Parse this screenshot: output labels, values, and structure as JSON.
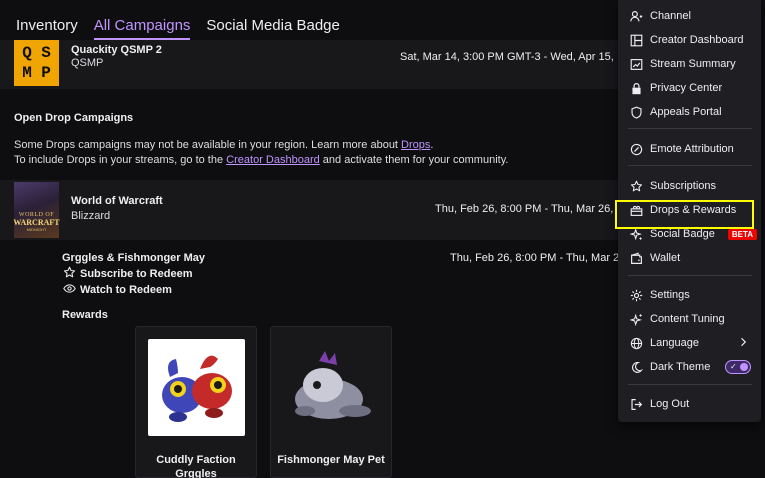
{
  "tabs": [
    {
      "label": "Inventory"
    },
    {
      "label": "All Campaigns"
    },
    {
      "label": "Social Media Badge"
    }
  ],
  "top_campaign": {
    "logo_letters": [
      "Q",
      "S",
      "M",
      "P"
    ],
    "title": "Quackity QSMP 2",
    "game": "QSMP",
    "dates": "Sat, Mar 14, 3:00 PM GMT-3 - Wed, Apr 15,"
  },
  "open_drops": {
    "heading": "Open Drop Campaigns",
    "line1_text": "Some Drops campaigns may not be available in your region. Learn more about ",
    "line1_link": "Drops",
    "line1_end": ".",
    "line2_text": "To include Drops in your streams, go to the ",
    "line2_link": "Creator Dashboard",
    "line2_end": " and activate them for your community."
  },
  "campaign": {
    "logo_text_1": "WORLD OF",
    "logo_text_2": "WARCRAFT",
    "logo_text_3": "MIDNIGHT",
    "title": "World of Warcraft",
    "publisher": "Blizzard",
    "dates": "Thu, Feb 26, 8:00 PM - Thu, Mar 26,"
  },
  "drop": {
    "name": "Grggles & Fishmonger May",
    "dates": "Thu, Feb 26, 8:00 PM - Thu, Mar 2",
    "requirements": [
      {
        "icon": "star-outline-icon",
        "label": "Subscribe to Redeem"
      },
      {
        "icon": "eye-icon",
        "label": "Watch to Redeem"
      }
    ],
    "rewards_heading": "Rewards",
    "rewards": [
      {
        "label": "Cuddly Faction Grggles"
      },
      {
        "label": "Fishmonger May Pet"
      }
    ]
  },
  "menu": {
    "items": [
      {
        "id": "channel",
        "label": "Channel",
        "icon": "person-icon"
      },
      {
        "id": "creator-dashboard",
        "label": "Creator Dashboard",
        "icon": "dashboard-icon"
      },
      {
        "id": "stream-summary",
        "label": "Stream Summary",
        "icon": "summary-icon"
      },
      {
        "id": "privacy-center",
        "label": "Privacy Center",
        "icon": "lock-icon"
      },
      {
        "id": "appeals-portal",
        "label": "Appeals Portal",
        "icon": "shield-icon"
      },
      {
        "id": "emote-attribution",
        "label": "Emote Attribution",
        "icon": "emote-icon"
      },
      {
        "id": "subscriptions",
        "label": "Subscriptions",
        "icon": "star-icon"
      },
      {
        "id": "drops-rewards",
        "label": "Drops & Rewards",
        "icon": "gift-icon"
      },
      {
        "id": "social-badge",
        "label": "Social Badge",
        "icon": "sparkle-icon",
        "badge": "BETA"
      },
      {
        "id": "wallet",
        "label": "Wallet",
        "icon": "wallet-icon"
      },
      {
        "id": "settings",
        "label": "Settings",
        "icon": "gear-icon"
      },
      {
        "id": "content-tuning",
        "label": "Content Tuning",
        "icon": "sparkle-icon"
      },
      {
        "id": "language",
        "label": "Language",
        "icon": "globe-icon"
      },
      {
        "id": "dark-theme",
        "label": "Dark Theme",
        "icon": "moon-icon",
        "toggle_on": true
      },
      {
        "id": "log-out",
        "label": "Log Out",
        "icon": "logout-icon"
      }
    ]
  },
  "colors": {
    "accent": "#bf94ff",
    "highlight": "#ffff00",
    "beta": "#eb0400",
    "background": "#0e0e10",
    "card": "#18181b",
    "menu": "#1f1f23"
  }
}
